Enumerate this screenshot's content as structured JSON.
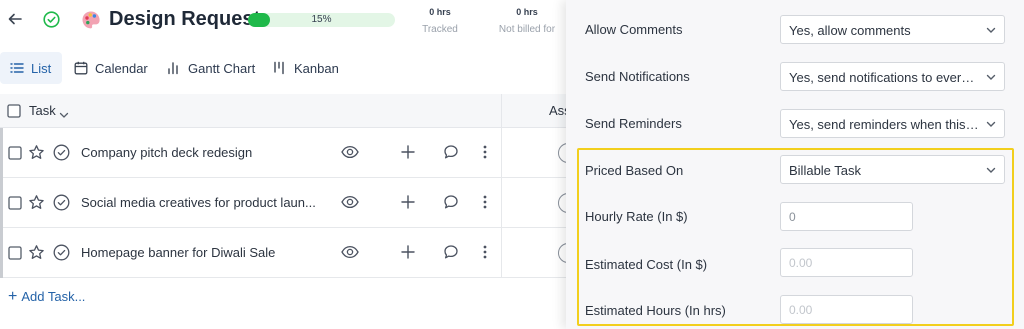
{
  "project": {
    "title": "Design Request",
    "progress_label": "15%",
    "progress_fraction": 0.15
  },
  "stats": [
    {
      "value": "0 hrs",
      "label": "Tracked"
    },
    {
      "value": "0 hrs",
      "label": "Not billed for"
    }
  ],
  "tabs": [
    {
      "label": "List",
      "icon": "list-icon",
      "active": true
    },
    {
      "label": "Calendar",
      "icon": "calendar-icon"
    },
    {
      "label": "Gantt Chart",
      "icon": "gantt-chart-icon"
    },
    {
      "label": "Kanban",
      "icon": "kanban-icon"
    }
  ],
  "table": {
    "task_header": "Task",
    "assignee_header": "Ass"
  },
  "tasks": [
    {
      "name": "Company pitch deck redesign"
    },
    {
      "name": "Social media creatives for product laun..."
    },
    {
      "name": "Homepage banner for Diwali Sale"
    }
  ],
  "add_task": "Add Task...",
  "settings": {
    "allow_comments": {
      "label": "Allow Comments",
      "value": "Yes, allow comments"
    },
    "send_notifications": {
      "label": "Send Notifications",
      "value": "Yes, send notifications to everyo..."
    },
    "send_reminders": {
      "label": "Send Reminders",
      "value": "Yes, send reminders when this is..."
    },
    "priced_based_on": {
      "label": "Priced Based On",
      "value": "Billable Task"
    },
    "hourly_rate": {
      "label": "Hourly Rate (In $)",
      "value": "0"
    },
    "estimated_cost": {
      "label": "Estimated Cost (In $)",
      "placeholder": "0.00"
    },
    "estimated_hours": {
      "label": "Estimated Hours (In hrs)",
      "placeholder": "0.00"
    }
  },
  "colors": {
    "accent": "#2563a8",
    "progress": "#1fb94a",
    "highlight": "#f2cf1d"
  }
}
